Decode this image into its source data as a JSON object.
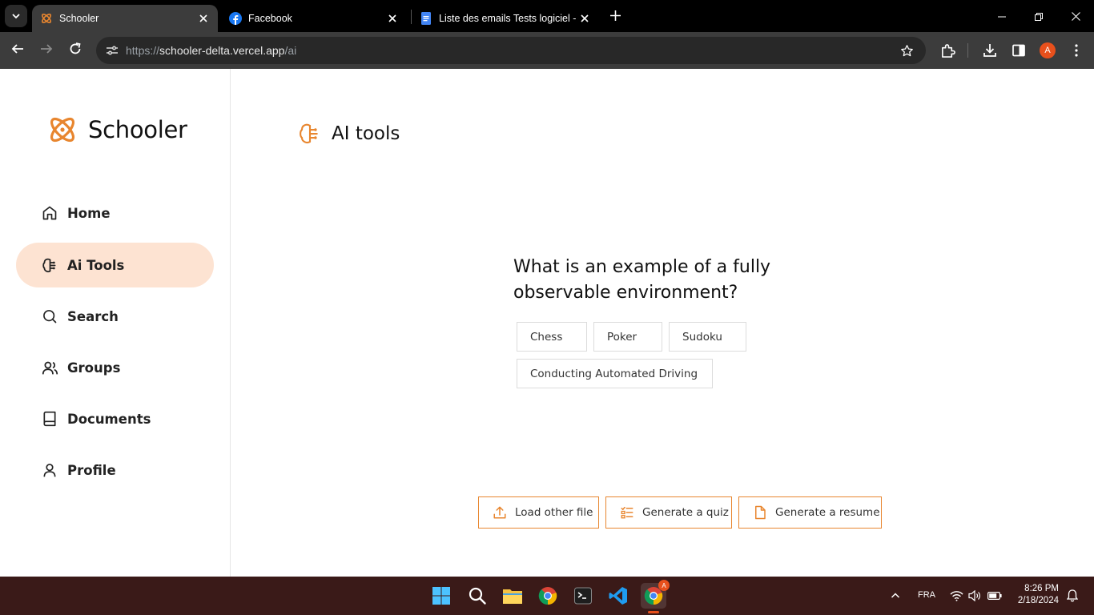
{
  "browser": {
    "tabs": [
      {
        "title": "Schooler",
        "favicon": "schooler-atom-icon",
        "active": true
      },
      {
        "title": "Facebook",
        "favicon": "facebook-icon",
        "active": false
      },
      {
        "title": "Liste des emails Tests logiciel - (",
        "favicon": "google-docs-icon",
        "active": false
      }
    ],
    "url_prefix": "https://",
    "url_host": "schooler-delta.vercel.app",
    "url_path": "/ai",
    "profile_initial": "A"
  },
  "app": {
    "brand_name": "Schooler",
    "accent_color": "#e8862f",
    "nav": [
      {
        "label": "Home",
        "icon": "home-icon",
        "active": false
      },
      {
        "label": "Ai Tools",
        "icon": "brain-circuit-icon",
        "active": true
      },
      {
        "label": "Search",
        "icon": "search-icon",
        "active": false
      },
      {
        "label": "Groups",
        "icon": "users-icon",
        "active": false
      },
      {
        "label": "Documents",
        "icon": "book-icon",
        "active": false
      },
      {
        "label": "Profile",
        "icon": "user-icon",
        "active": false
      }
    ],
    "page_title": "AI tools",
    "quiz": {
      "question": "What is an example of a fully observable environment?",
      "answers": [
        "Chess",
        "Poker",
        "Sudoku",
        "Conducting Automated Driving"
      ]
    },
    "actions": {
      "load_file": "Load other file",
      "generate_quiz": "Generate a quiz",
      "generate_resume": "Generate a resume"
    }
  },
  "taskbar": {
    "language": "FRA",
    "time": "8:26 PM",
    "date": "2/18/2024",
    "chrome_badge": "A"
  }
}
